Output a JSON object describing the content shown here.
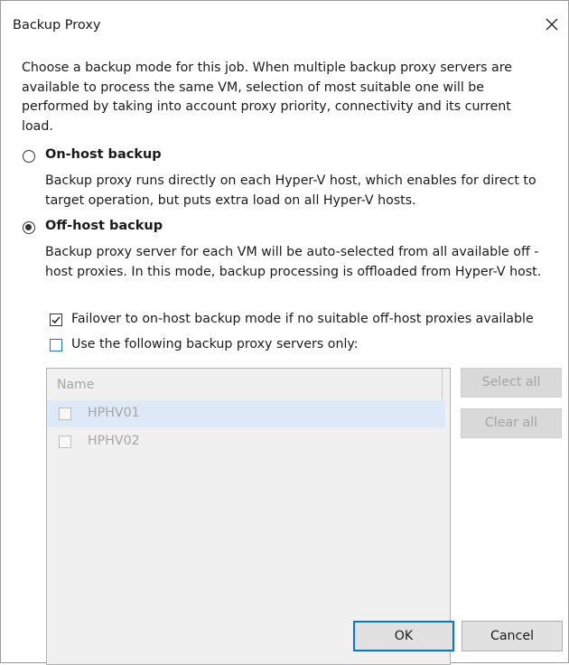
{
  "window": {
    "title": "Backup Proxy",
    "close_icon": "close-icon"
  },
  "intro": "Choose a backup mode for this job. When multiple backup proxy servers are available to process the same VM, selection of most suitable one will be performed by taking into account proxy priority, connectivity and its current load.",
  "modes": {
    "on_host": {
      "label": "On-host backup",
      "selected": false,
      "description": "Backup proxy runs directly on each Hyper-V host, which enables for direct to target operation, but puts extra load on all Hyper-V hosts."
    },
    "off_host": {
      "label": "Off-host backup",
      "selected": true,
      "description": "Backup proxy server for each VM will be auto-selected from all available off -host proxies. In this mode, backup processing is offloaded from Hyper-V host."
    }
  },
  "options": {
    "failover": {
      "label": "Failover to on-host backup mode if no suitable off-host proxies available",
      "checked": true
    },
    "use_following": {
      "label": "Use the following backup proxy servers only:",
      "checked": false
    }
  },
  "proxy_list": {
    "header": "Name",
    "enabled": false,
    "rows": [
      {
        "name": "HPHV01",
        "checked": false,
        "selected": true
      },
      {
        "name": "HPHV02",
        "checked": false,
        "selected": false
      }
    ]
  },
  "side_buttons": {
    "select_all": "Select all",
    "clear_all": "Clear all"
  },
  "footer": {
    "ok": "OK",
    "cancel": "Cancel"
  },
  "colors": {
    "accent": "#0078d7",
    "checkbox_focus": "#1a74c9",
    "disabled_text": "#a6a6a6",
    "selected_row": "#dde9f7"
  }
}
